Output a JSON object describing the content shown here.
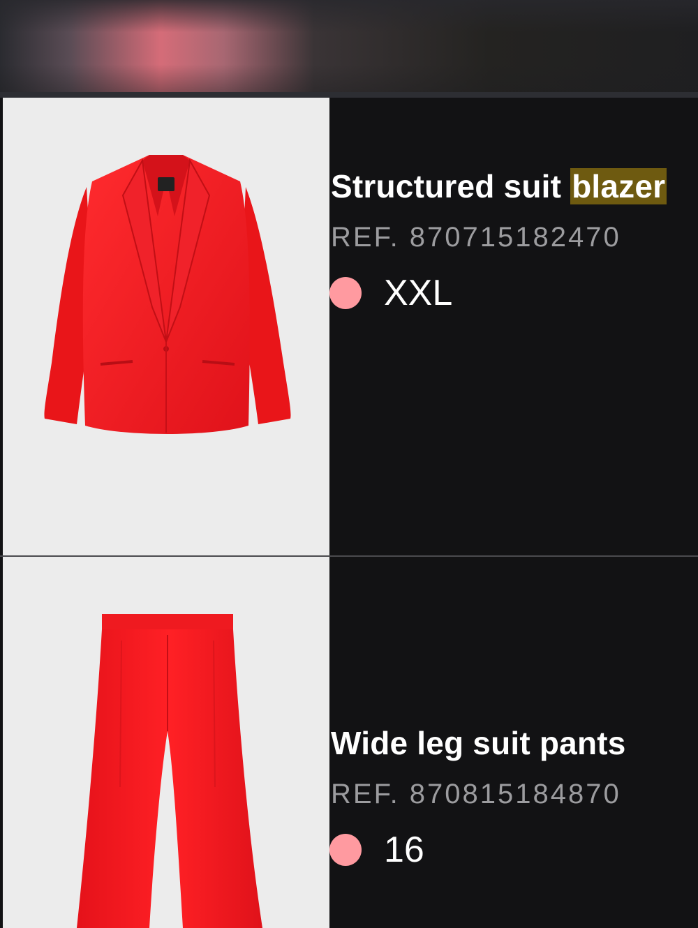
{
  "products": [
    {
      "title_prefix": "Structured suit ",
      "title_highlight": "blazer",
      "ref": "REF. 870715182470",
      "size": "XXL",
      "color_swatch": "#ff9aa0",
      "image_icon": "red-blazer-image"
    },
    {
      "title_prefix": "Wide leg suit pants",
      "title_highlight": "",
      "ref": "REF. 870815184870",
      "size": "16",
      "color_swatch": "#ff9aa0",
      "image_icon": "red-pants-image"
    }
  ],
  "colors": {
    "background": "#121214",
    "highlight": "#6e5a10",
    "garment": "#ee1a1f"
  }
}
